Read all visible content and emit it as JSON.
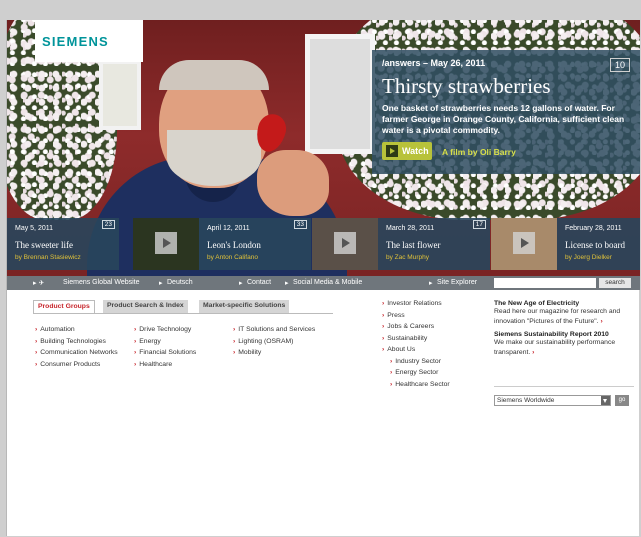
{
  "brand": {
    "logo": "SIEMENS"
  },
  "feature": {
    "kicker": "/answers – May 26, 2011",
    "count": "10",
    "title": "Thirsty strawberries",
    "description": "One basket of strawberries needs 12 gallons of water. For farmer George in Orange County, California, sufficient clean water is a pivotal commodity.",
    "watch_label": "Watch",
    "film_credit": "A film by Oli Barry"
  },
  "stories": [
    {
      "date": "May 5, 2011",
      "num": "23",
      "title": "The sweeter life",
      "by": "by Brennan Stasiewicz"
    },
    {
      "date": "April 12, 2011",
      "num": "33",
      "title": "Leon's London",
      "by": "by Anton Califano"
    },
    {
      "date": "March 28, 2011",
      "num": "17",
      "title": "The last flower",
      "by": "by Zac Murphy"
    },
    {
      "date": "February 28, 2011",
      "num": "",
      "title": "License to board",
      "by": "by Joerg Dielker"
    }
  ],
  "nav": {
    "global": "Siemens Global Website",
    "deutsch": "Deutsch",
    "contact": "Contact",
    "social": "Social Media & Mobile",
    "explorer": "Site Explorer",
    "search_btn": "search"
  },
  "tabs": [
    "Product Groups",
    "Product Search & Index",
    "Market-specific Solutions"
  ],
  "products": {
    "col1": [
      "Automation",
      "Building Technologies",
      "Communication Networks",
      "Consumer Products"
    ],
    "col2": [
      "Drive Technology",
      "Energy",
      "Financial Solutions",
      "Healthcare"
    ],
    "col3": [
      "IT Solutions and Services",
      "Lighting (OSRAM)",
      "Mobility"
    ]
  },
  "links": {
    "main": [
      "Investor Relations",
      "Press",
      "Jobs & Careers",
      "Sustainability",
      "About Us"
    ],
    "sectors": [
      "Industry Sector",
      "Energy Sector",
      "Healthcare Sector"
    ]
  },
  "promo": {
    "head1": "The New Age of Electricity",
    "text1": "Read here our magazine for research and innovation \"Pictures of the Future\".",
    "head2": "Siemens Sustainability Report 2010",
    "text2": "We make our sustainability performance transparent.",
    "select_value": "Siemens Worldwide",
    "go": "go"
  },
  "colors": {
    "accent_red": "#c6242a",
    "teal": "#00949a",
    "panel": "#304e62",
    "nav": "#6f767c"
  }
}
